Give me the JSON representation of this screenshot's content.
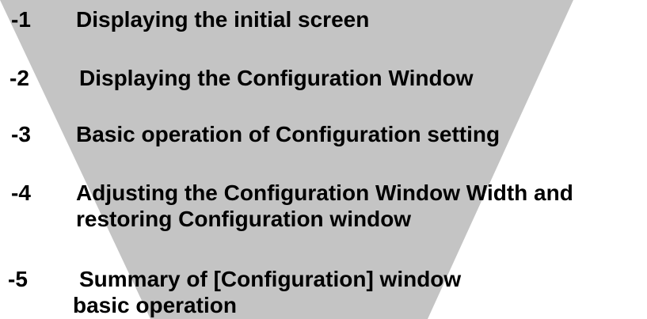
{
  "colors": {
    "background": "#ffffff",
    "funnel": "#c4c4c4",
    "text": "#000000"
  },
  "items": [
    {
      "number": "-1",
      "lines": [
        "Displaying the initial screen"
      ]
    },
    {
      "number": "-2",
      "lines": [
        "Displaying the Configuration Window"
      ]
    },
    {
      "number": "-3",
      "lines": [
        "Basic operation of Configuration setting"
      ]
    },
    {
      "number": "-4",
      "lines": [
        "Adjusting the Configuration Window Width and",
        "restoring Configuration window"
      ]
    },
    {
      "number": "-5",
      "lines": [
        "Summary of [Configuration] window",
        "basic operation"
      ]
    }
  ]
}
